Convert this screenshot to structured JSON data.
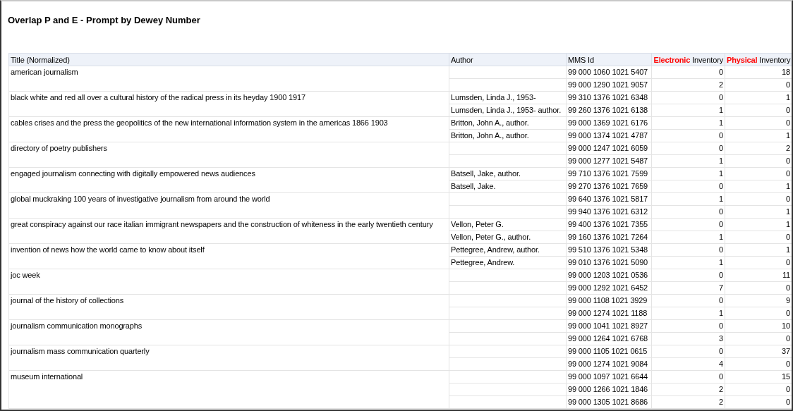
{
  "report": {
    "title": "Overlap P and E - Prompt by Dewey Number"
  },
  "table": {
    "columns": [
      {
        "label": "Title (Normalized)",
        "kind": "text"
      },
      {
        "label": "Author",
        "kind": "text"
      },
      {
        "label": "MMS Id",
        "kind": "text"
      },
      {
        "highlight": "Electronic",
        "label": "Inventory",
        "kind": "count"
      },
      {
        "highlight": "Physical",
        "label": "Inventory",
        "kind": "count"
      }
    ],
    "groups": [
      {
        "title": "american journalism",
        "records": [
          {
            "mms_id": "99 000 1060 1021 5407",
            "electronic": "0",
            "physical": "18"
          },
          {
            "mms_id": "99 000 1290 1021 9057",
            "electronic": "2",
            "physical": "0"
          }
        ]
      },
      {
        "title": "black white and red all over a cultural history of the radical press in its heyday 1900 1917",
        "records": [
          {
            "author": "Lumsden, Linda J., 1953-",
            "mms_id": "99 310 1376 1021 6348",
            "electronic": "0",
            "physical": "1"
          },
          {
            "author": "Lumsden, Linda J., 1953- author.",
            "mms_id": "99 260 1376 1021 6138",
            "electronic": "1",
            "physical": "0"
          }
        ]
      },
      {
        "title": "cables crises and the press the geopolitics of the new international information system in the americas 1866 1903",
        "records": [
          {
            "author": "Britton, John A., author.",
            "mms_id": "99 000 1369 1021 6176",
            "electronic": "1",
            "physical": "0"
          },
          {
            "author": "Britton, John A., author.",
            "mms_id": "99 000 1374 1021 4787",
            "electronic": "0",
            "physical": "1"
          }
        ]
      },
      {
        "title": "directory of poetry publishers",
        "records": [
          {
            "mms_id": "99 000 1247 1021 6059",
            "electronic": "0",
            "physical": "2"
          },
          {
            "mms_id": "99 000 1277 1021 5487",
            "electronic": "1",
            "physical": "0"
          }
        ]
      },
      {
        "title": "engaged journalism connecting with digitally empowered news audiences",
        "records": [
          {
            "author": "Batsell, Jake, author.",
            "mms_id": "99 710 1376 1021 7599",
            "electronic": "1",
            "physical": "0"
          },
          {
            "author": "Batsell, Jake.",
            "mms_id": "99 270 1376 1021 7659",
            "electronic": "0",
            "physical": "1"
          }
        ]
      },
      {
        "title": "global muckraking 100 years of investigative journalism from around the world",
        "records": [
          {
            "mms_id": "99 640 1376 1021 5817",
            "electronic": "1",
            "physical": "0"
          },
          {
            "mms_id": "99 940 1376 1021 6312",
            "electronic": "0",
            "physical": "1"
          }
        ]
      },
      {
        "title": "great conspiracy against our race italian immigrant newspapers and the construction of whiteness in the early twentieth century",
        "records": [
          {
            "author": "Vellon, Peter G.",
            "mms_id": "99 400 1376 1021 7355",
            "electronic": "0",
            "physical": "1"
          },
          {
            "author": "Vellon, Peter G., author.",
            "mms_id": "99 160 1376 1021 7264",
            "electronic": "1",
            "physical": "0"
          }
        ]
      },
      {
        "title": "invention of news how the world came to know about itself",
        "records": [
          {
            "author": "Pettegree, Andrew, author.",
            "mms_id": "99 510 1376 1021 5348",
            "electronic": "0",
            "physical": "1"
          },
          {
            "author": "Pettegree, Andrew.",
            "mms_id": "99 010 1376 1021 5090",
            "electronic": "1",
            "physical": "0"
          }
        ]
      },
      {
        "title": "joc week",
        "records": [
          {
            "mms_id": "99 000 1203 1021 0536",
            "electronic": "0",
            "physical": "11"
          },
          {
            "mms_id": "99 000 1292 1021 6452",
            "electronic": "7",
            "physical": "0"
          }
        ]
      },
      {
        "title": "journal of the history of collections",
        "records": [
          {
            "mms_id": "99 000 1108 1021 3929",
            "electronic": "0",
            "physical": "9"
          },
          {
            "mms_id": "99 000 1274 1021 1188",
            "electronic": "1",
            "physical": "0"
          }
        ]
      },
      {
        "title": "journalism communication monographs",
        "records": [
          {
            "mms_id": "99 000 1041 1021 8927",
            "electronic": "0",
            "physical": "10"
          },
          {
            "mms_id": "99 000 1264 1021 6768",
            "electronic": "3",
            "physical": "0"
          }
        ]
      },
      {
        "title": "journalism mass communication quarterly",
        "records": [
          {
            "mms_id": "99 000 1105 1021 0615",
            "electronic": "0",
            "physical": "37"
          },
          {
            "mms_id": "99 000 1274 1021 9084",
            "electronic": "4",
            "physical": "0"
          }
        ]
      },
      {
        "title": "museum international",
        "records": [
          {
            "mms_id": "99 000 1097 1021 6644",
            "electronic": "0",
            "physical": "15"
          },
          {
            "mms_id": "99 000 1266 1021 1846",
            "electronic": "2",
            "physical": "0"
          },
          {
            "mms_id": "99 000 1305 1021 8686",
            "electronic": "2",
            "physical": "0"
          }
        ]
      }
    ]
  }
}
